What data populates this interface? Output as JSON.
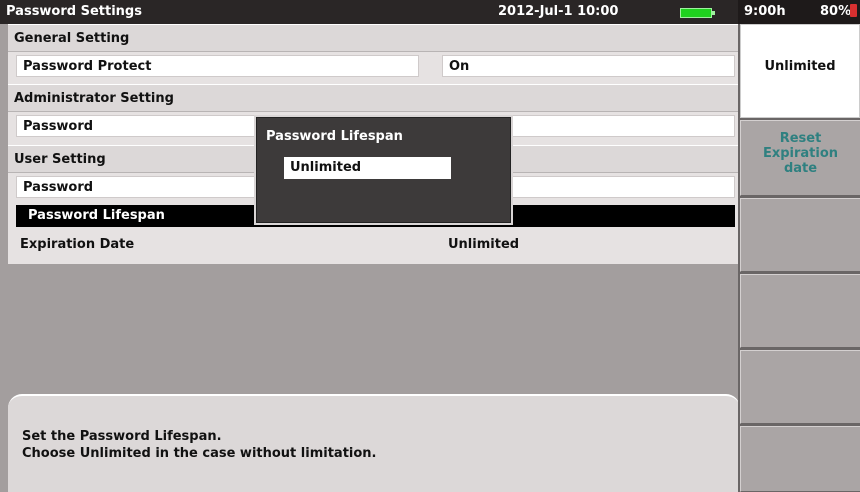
{
  "header": {
    "title": "Password Settings",
    "datetime": "2012-Jul-1 10:00",
    "battery_icon": "battery-icon",
    "battery_color": "#1fd21f"
  },
  "status": {
    "time": "9:00h",
    "battery_percent": "80%",
    "battery_icon": "battery-icon",
    "battery_color": "#d83030"
  },
  "general": {
    "heading": "General Setting",
    "rows": [
      {
        "label": "Password Protect",
        "value": "On"
      }
    ]
  },
  "administrator": {
    "heading": "Administrator Setting",
    "rows": [
      {
        "label": "Password",
        "value": "*****"
      }
    ]
  },
  "user": {
    "heading": "User Setting",
    "rows": [
      {
        "label": "Password",
        "value": ""
      },
      {
        "label": "Password Lifespan",
        "value": ""
      },
      {
        "label": "Expiration Date",
        "value": "Unlimited"
      }
    ]
  },
  "dialog": {
    "title": "Password Lifespan",
    "value": "Unlimited"
  },
  "help": {
    "lines": [
      "Set the Password Lifespan.",
      "Choose Unlimited in the case without limitation."
    ]
  },
  "softkeys": [
    {
      "lines": [
        "Unlimited"
      ]
    },
    {
      "lines": [
        "Reset",
        "Expiration",
        "date"
      ]
    },
    {
      "lines": []
    },
    {
      "lines": []
    },
    {
      "lines": []
    },
    {
      "lines": []
    }
  ],
  "colors": {
    "accent_teal": "#2f8080",
    "selection": "#000000"
  }
}
